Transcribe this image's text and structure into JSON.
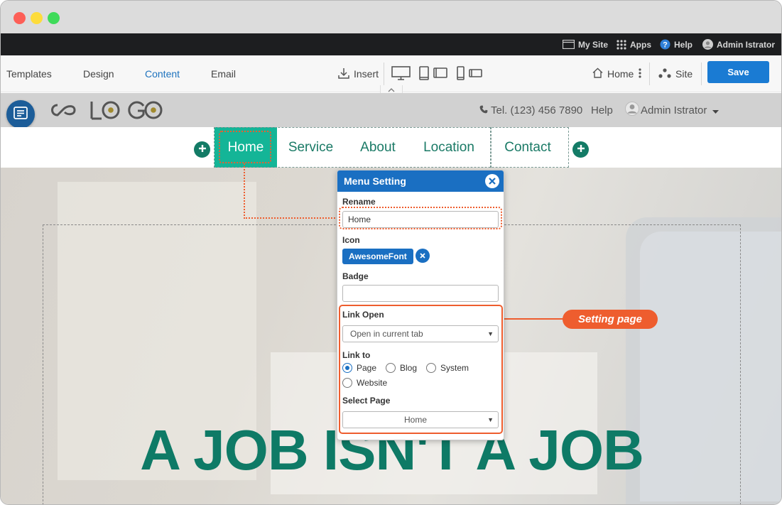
{
  "admin_bar": {
    "my_site": "My Site",
    "apps": "Apps",
    "help": "Help",
    "user": "Admin Istrator"
  },
  "toolbar": {
    "tabs": [
      "Templates",
      "Design",
      "Content",
      "Email"
    ],
    "active_tab": "Content",
    "insert": "Insert",
    "home": "Home",
    "site": "Site",
    "save": "Save"
  },
  "site_header": {
    "logo": "LOGO",
    "phone": "Tel. (123) 456 7890",
    "help": "Help",
    "user": "Admin Istrator"
  },
  "menu": {
    "items": [
      "Home",
      "Service",
      "About",
      "Location",
      "Contact"
    ],
    "active": "Home"
  },
  "hero": {
    "title": "A JOB ISN'T A JOB"
  },
  "dialog": {
    "title": "Menu Setting",
    "rename_label": "Rename",
    "rename_value": "Home",
    "icon_label": "Icon",
    "icon_value": "AwesomeFont",
    "badge_label": "Badge",
    "badge_value": "",
    "link_open_label": "Link Open",
    "link_open_value": "Open in current tab",
    "link_to_label": "Link to",
    "link_to_options": [
      "Page",
      "Blog",
      "System",
      "Website"
    ],
    "link_to_selected": "Page",
    "select_page_label": "Select Page",
    "select_page_value": "Home"
  },
  "callout": {
    "label": "Setting page"
  },
  "colors": {
    "brand_blue": "#1a6fc2",
    "menu_green": "#14b597",
    "text_green": "#1a7a66",
    "callout_orange": "#ee5d2e"
  }
}
